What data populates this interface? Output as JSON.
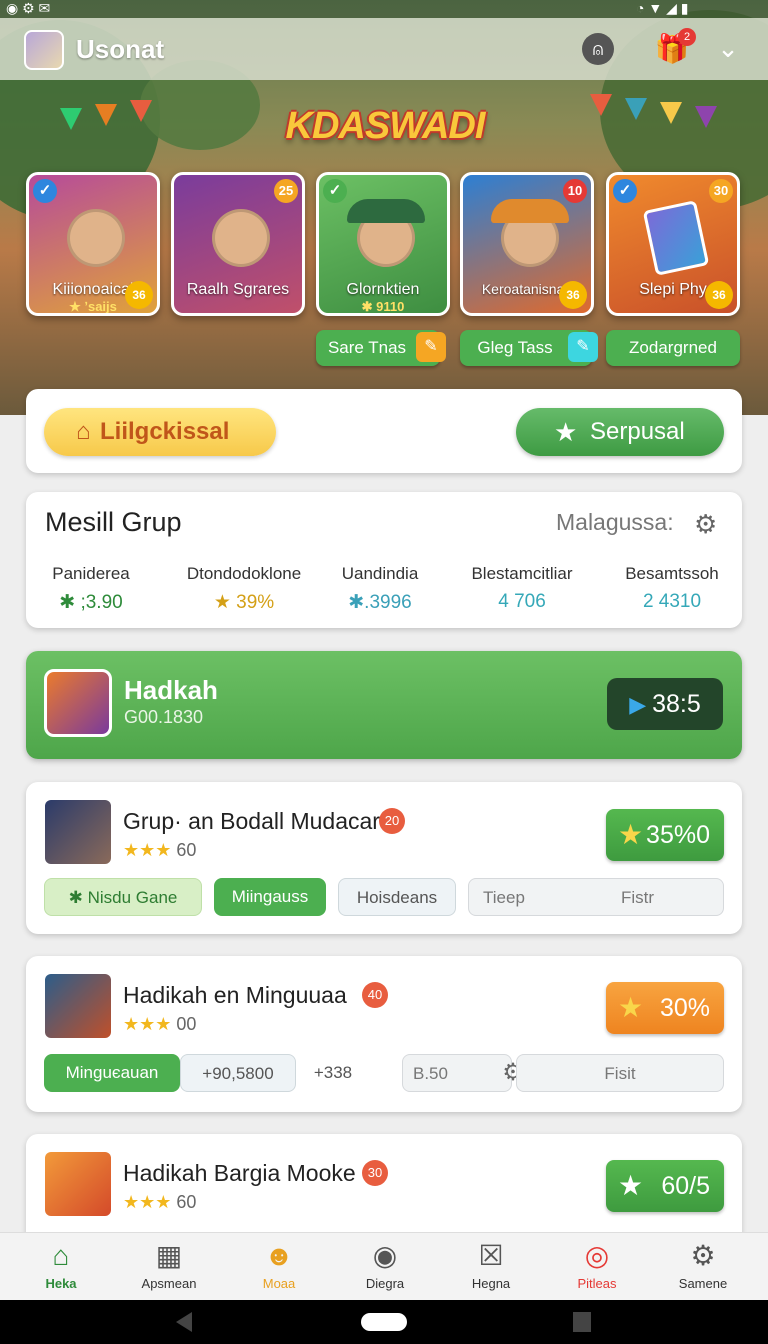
{
  "header": {
    "title": "Usonat",
    "logo": "KDASWADI",
    "bell_icon": "bell-icon",
    "gift_badge": "2"
  },
  "cards": [
    {
      "name": "Kiiionoaical",
      "sub": "★ ʼsaijs",
      "coin": "36"
    },
    {
      "name": "Raalh Sgrares",
      "num": "25"
    },
    {
      "name": "Glornktien",
      "sub": "✱ 9110"
    },
    {
      "name": "Keroatanisnan",
      "num": "10",
      "coin": "36"
    },
    {
      "name": "Slepi Phy",
      "num": "30",
      "coin": "36"
    }
  ],
  "card_buttons": [
    "Sare Tnas",
    "Gleg Tass",
    "Zodargrned"
  ],
  "actions": {
    "left": "Liilgckissal",
    "right": "Serpusal"
  },
  "group": {
    "title": "Mesill Grup",
    "right_label": "Malagussa:",
    "stats": [
      {
        "label": "Paniderea",
        "value": "✱ ;3.90",
        "color": "#2e8b3a"
      },
      {
        "label": "Dtondodoklone",
        "value": "★ 39%",
        "color": "#d4a017"
      },
      {
        "label": "Uandindia",
        "value": "✱.3996",
        "color": "#3aa0b8"
      },
      {
        "label": "Blestamcitliar",
        "value": "4 706",
        "color": "#35a8b8"
      },
      {
        "label": "Besamtssoh",
        "value": "2 4310",
        "color": "#35a8b8"
      }
    ]
  },
  "highlight": {
    "title": "Hadkah",
    "sub": "G00.1830",
    "value": "38:5"
  },
  "items": [
    {
      "title": "Grup· an Bodall Mudacar",
      "badge": "20",
      "rating": "60",
      "pct": "35%0",
      "chips": [
        "✱ Nisdu Gane",
        "Miingauss",
        "Hoisdeans"
      ],
      "chip_field": "Tieep",
      "chip_field2": "Fistr"
    },
    {
      "title": "Hadikah en Minguuaa",
      "badge": "40",
      "rating": "00",
      "pct": "30%",
      "chips": [
        "Minguєauan",
        "+90,5800"
      ],
      "chip_extra": "+338",
      "chip_field": "B.50",
      "chip_field2": "Fisit"
    },
    {
      "title": "Hadikah Bargia Mooke",
      "badge": "30",
      "rating": "60",
      "pct": "60/5"
    }
  ],
  "nav": [
    {
      "label": "Heka",
      "icon": "home-icon"
    },
    {
      "label": "Apsmean",
      "icon": "grid-icon"
    },
    {
      "label": "Moaa",
      "icon": "smile-icon"
    },
    {
      "label": "Diegra",
      "icon": "pin-icon"
    },
    {
      "label": "Hegna",
      "icon": "close-box-icon"
    },
    {
      "label": "Pitleas",
      "icon": "target-icon"
    },
    {
      "label": "Samene",
      "icon": "gear-icon"
    }
  ],
  "colors": {
    "green": "#4caf50",
    "orange": "#f5a623",
    "red": "#e85d3f",
    "yellow": "#f7c94a"
  }
}
